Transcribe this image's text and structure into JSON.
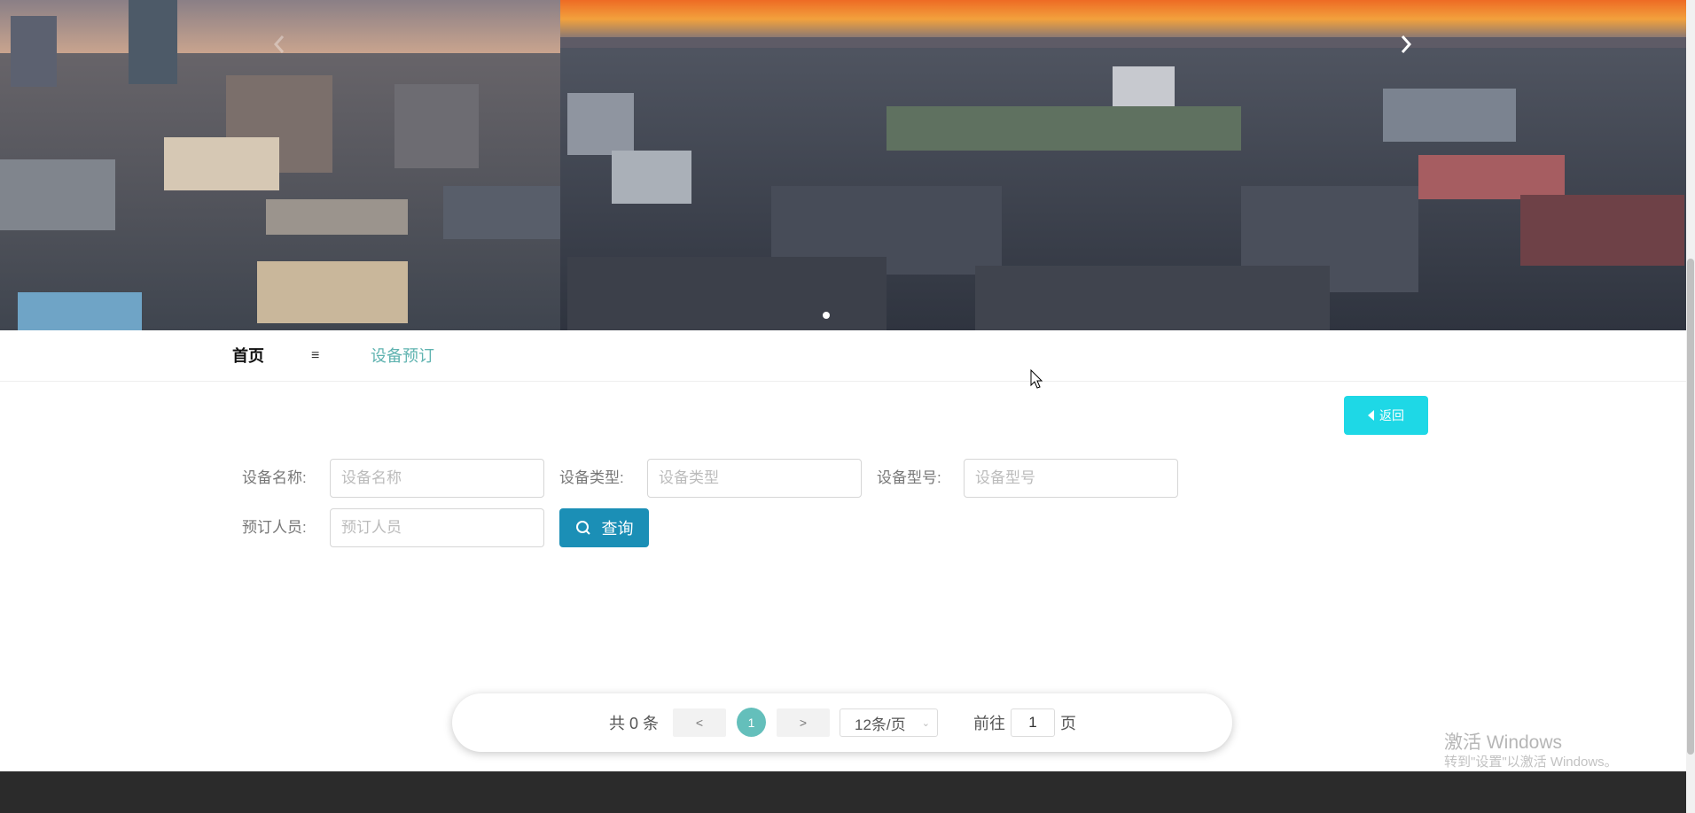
{
  "carousel": {
    "prev_glyph": "‹",
    "next_glyph": "›",
    "slide_count": 1,
    "active_slide": 1
  },
  "nav": {
    "home": "首页",
    "menu_glyph": "≡",
    "current": "设备预订"
  },
  "back_button": {
    "label": "返回",
    "icon": "caret-left-icon"
  },
  "search": {
    "fields": [
      {
        "label": "设备名称:",
        "placeholder": "设备名称",
        "value": ""
      },
      {
        "label": "设备类型:",
        "placeholder": "设备类型",
        "value": ""
      },
      {
        "label": "设备型号:",
        "placeholder": "设备型号",
        "value": ""
      },
      {
        "label": "预订人员:",
        "placeholder": "预订人员",
        "value": ""
      }
    ],
    "button_label": "查询",
    "button_icon": "search-icon"
  },
  "pagination": {
    "total": "共 0 条",
    "prev": "<",
    "current_page": "1",
    "next": ">",
    "page_size": "12条/页",
    "goto_label": "前往",
    "goto_value": "1",
    "page_suffix": "页"
  },
  "watermark": {
    "title": "激活 Windows",
    "subtitle": "转到\"设置\"以激活 Windows。"
  },
  "colors": {
    "accent_teal": "#64bfbb",
    "back_button": "#1ed8e6",
    "search_button": "#1b8fb6",
    "footer": "#2b2b2b"
  }
}
